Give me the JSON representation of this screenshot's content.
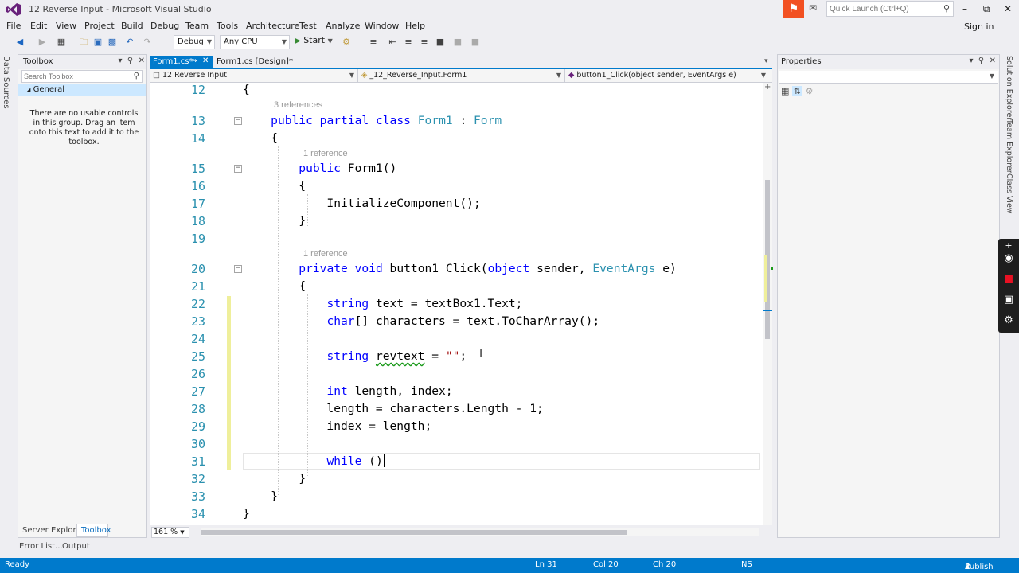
{
  "window": {
    "title": "12 Reverse Input - Microsoft Visual Studio",
    "quick_launch_placeholder": "Quick Launch (Ctrl+Q)",
    "sign_in": "Sign in"
  },
  "menu": [
    "File",
    "Edit",
    "View",
    "Project",
    "Build",
    "Debug",
    "Team",
    "Tools",
    "Architecture",
    "Test",
    "Analyze",
    "Window",
    "Help"
  ],
  "toolbar": {
    "config": "Debug",
    "platform": "Any CPU",
    "start_label": "Start"
  },
  "left_strip": {
    "data_sources": "Data Sources"
  },
  "toolbox": {
    "title": "Toolbox",
    "search_placeholder": "Search Toolbox",
    "group": "General",
    "empty_message": "There are no usable controls in this group. Drag an item onto this text to add it to the toolbox."
  },
  "bottom_tabs": {
    "server_explorer": "Server Explorer",
    "toolbox": "Toolbox",
    "error_list": "Error List...",
    "output": "Output"
  },
  "doc_tabs": {
    "active": "Form1.cs*",
    "second": "Form1.cs [Design]*"
  },
  "navbar": {
    "project": "12 Reverse Input",
    "class": "_12_Reverse_Input.Form1",
    "member": "button1_Click(object sender, EventArgs e)"
  },
  "editor": {
    "zoom": "161 %",
    "refs": [
      "3 references",
      "1 reference",
      "1 reference"
    ],
    "lines": [
      "12",
      "13",
      "14",
      "15",
      "16",
      "17",
      "18",
      "19",
      "20",
      "21",
      "22",
      "23",
      "24",
      "25",
      "26",
      "27",
      "28",
      "29",
      "30",
      "31",
      "32",
      "33",
      "34"
    ]
  },
  "properties": {
    "title": "Properties"
  },
  "right_strip": {
    "solution_explorer": "Solution Explorer",
    "team_explorer": "Team Explorer",
    "class_view": "Class View"
  },
  "status": {
    "state": "Ready",
    "ln": "Ln 31",
    "col": "Col 20",
    "ch": "Ch 20",
    "mode": "INS",
    "publish": "Publish"
  },
  "colors": {
    "accent": "#007acc",
    "keyword": "#0000ff",
    "type": "#2b91af",
    "string": "#a31515",
    "notification": "#f25022"
  }
}
